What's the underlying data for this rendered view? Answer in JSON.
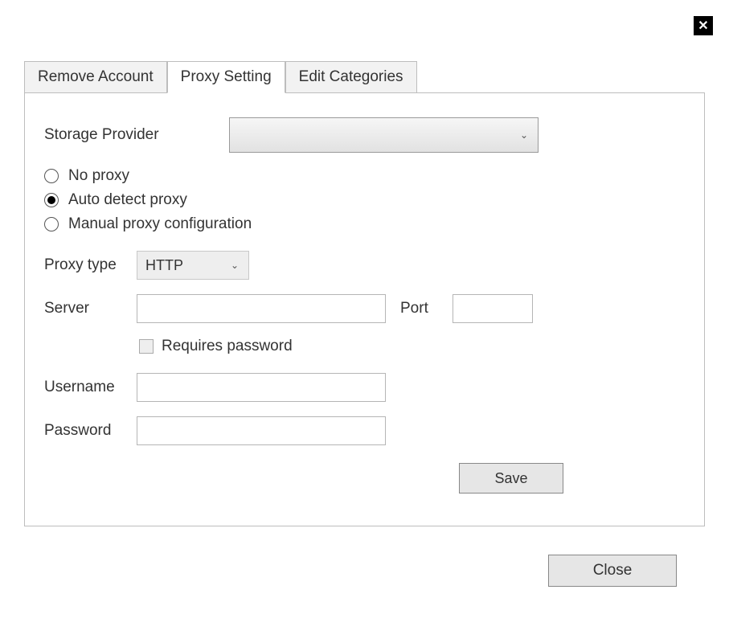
{
  "close_icon": "✕",
  "tabs": [
    {
      "label": "Remove Account"
    },
    {
      "label": "Proxy Setting"
    },
    {
      "label": "Edit Categories"
    }
  ],
  "active_tab_index": 1,
  "panel": {
    "storage_provider_label": "Storage Provider",
    "storage_provider_value": "",
    "proxy_options": {
      "no_proxy": "No proxy",
      "auto_detect": "Auto detect proxy",
      "manual": "Manual proxy configuration",
      "selected": "auto_detect"
    },
    "proxy_type_label": "Proxy type",
    "proxy_type_value": "HTTP",
    "server_label": "Server",
    "server_value": "",
    "port_label": "Port",
    "port_value": "",
    "requires_password_label": "Requires password",
    "requires_password_checked": false,
    "username_label": "Username",
    "username_value": "",
    "password_label": "Password",
    "password_value": "",
    "save_button": "Save"
  },
  "close_button": "Close"
}
